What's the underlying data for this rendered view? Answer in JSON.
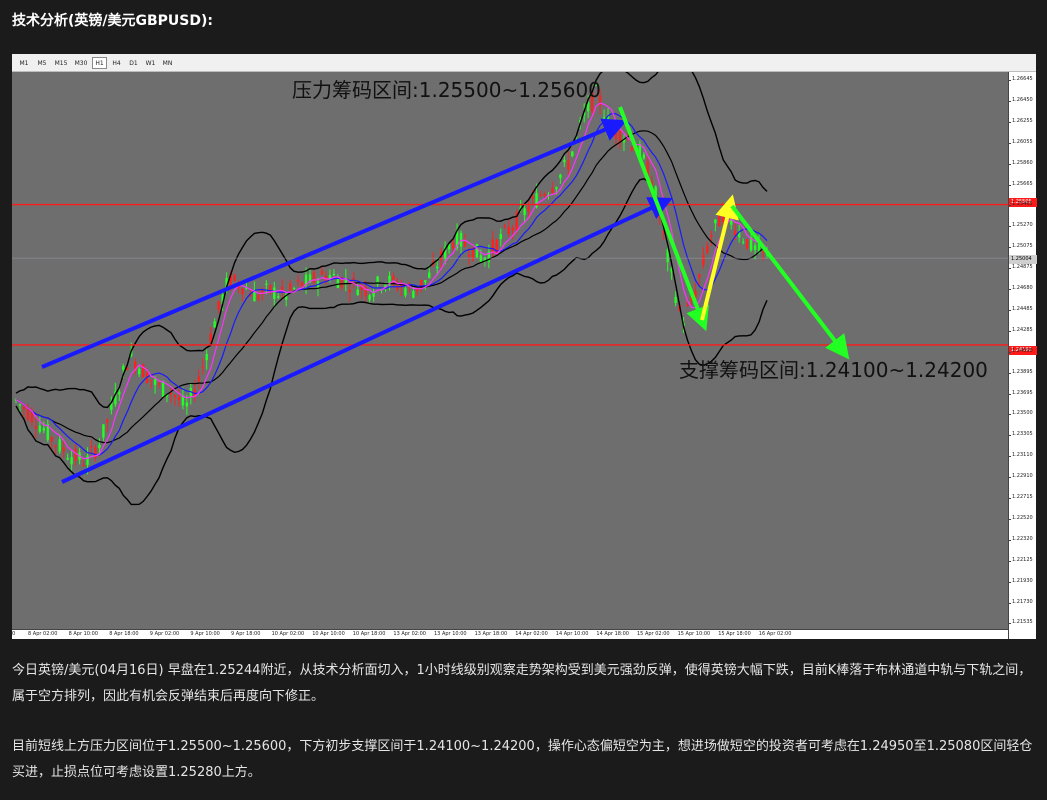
{
  "page": {
    "heading": "技术分析(英镑/美元GBPUSD):",
    "paragraph_1": "今日英镑/美元(04月16日) 早盘在1.25244附近，从技术分析面切入，1小时线级别观察走势架构受到美元强劲反弹，使得英镑大幅下跌，目前K棒落于布林通道中轨与下轨之间，属于空方排列，因此有机会反弹结束后再度向下修正。",
    "paragraph_2": "目前短线上方压力区间位于1.25500~1.25600，下方初步支撑区间于1.24100~1.24200，操作心态偏短空为主，想进场做短空的投资者可考虑在1.24950至1.25080区间轻仓买进，止损点位可考虑设置1.25280上方。"
  },
  "chart": {
    "timeframes": [
      "M1",
      "M5",
      "M15",
      "M30",
      "H1",
      "H4",
      "D1",
      "W1",
      "MN"
    ],
    "active_timeframe": "H1",
    "resistance_label": "压力筹码区间:1.25500~1.25600",
    "support_label": "支撑筹码区间:1.24100~1.24200",
    "resistance_tag": "1.25505",
    "support_tag": "1.24192",
    "current_tag": "1.25004",
    "price_ticks": [
      "1.26645",
      "1.26450",
      "1.26255",
      "1.26055",
      "1.25860",
      "1.25665",
      "1.25465",
      "1.25270",
      "1.25075",
      "1.24875",
      "1.24680",
      "1.24485",
      "1.24285",
      "1.24090",
      "1.23895",
      "1.23695",
      "1.23500",
      "1.23305",
      "1.23110",
      "1.22910",
      "1.22715",
      "1.22520",
      "1.22320",
      "1.22125",
      "1.21930",
      "1.21730",
      "1.21535"
    ],
    "time_labels": [
      "8 Apr 02:00",
      "8 Apr 10:00",
      "8 Apr 18:00",
      "9 Apr 02:00",
      "9 Apr 10:00",
      "9 Apr 18:00",
      "10 Apr 02:00",
      "10 Apr 10:00",
      "10 Apr 18:00",
      "13 Apr 02:00",
      "13 Apr 10:00",
      "13 Apr 18:00",
      "14 Apr 02:00",
      "14 Apr 10:00",
      "14 Apr 18:00",
      "15 Apr 02:00",
      "15 Apr 10:00",
      "15 Apr 18:00",
      "16 Apr 02:00"
    ],
    "x_first_label": "0",
    "colors": {
      "background": "#6e6e6e",
      "level_line": "#ff1a1a",
      "trend_arrow": "#1a1aff",
      "down_arrow": "#22ff22",
      "up_arrow": "#ffff22",
      "bull_candle": "#22ff22",
      "bear_candle": "#ff2020",
      "ma_fast": "#ff33ff",
      "ma_slow": "#1a1aff",
      "bollinger": "#000000"
    }
  },
  "chart_data": {
    "type": "candlestick",
    "symbol": "GBPUSD",
    "timeframe": "H1",
    "ylim": [
      1.21535,
      1.26745
    ],
    "levels": [
      {
        "name": "压力筹码区间",
        "price": 1.25505
      },
      {
        "name": "支撑筹码区间",
        "price": 1.24192
      }
    ],
    "current_price": 1.25004,
    "trend": [
      1.2367,
      1.2355,
      1.234,
      1.2325,
      1.2315,
      1.231,
      1.233,
      1.237,
      1.241,
      1.2395,
      1.238,
      1.2375,
      1.236,
      1.239,
      1.244,
      1.248,
      1.2475,
      1.2465,
      1.247,
      1.2465,
      1.2475,
      1.248,
      1.2485,
      1.248,
      1.2475,
      1.247,
      1.248,
      1.2475,
      1.247,
      1.248,
      1.25,
      1.252,
      1.251,
      1.25,
      1.2515,
      1.253,
      1.2545,
      1.256,
      1.257,
      1.259,
      1.263,
      1.2655,
      1.262,
      1.2615,
      1.26,
      1.257,
      1.25,
      1.244,
      1.247,
      1.252,
      1.2545,
      1.2525,
      1.251,
      1.25
    ]
  }
}
